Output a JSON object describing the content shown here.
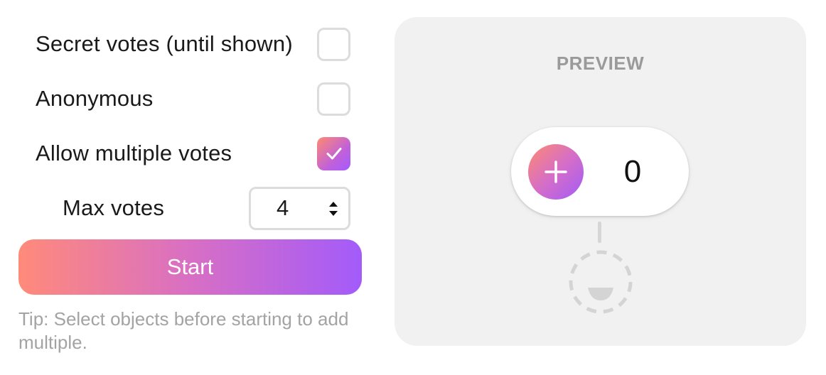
{
  "settings": {
    "secret_votes": {
      "label": "Secret votes (until shown)",
      "checked": false
    },
    "anonymous": {
      "label": "Anonymous",
      "checked": false
    },
    "allow_multiple": {
      "label": "Allow multiple votes",
      "checked": true
    },
    "max_votes": {
      "label": "Max votes",
      "value": "4"
    }
  },
  "start_button": {
    "label": "Start"
  },
  "tip": "Tip: Select objects before starting to add multiple.",
  "preview": {
    "title": "PREVIEW",
    "vote_count": "0"
  },
  "colors": {
    "gradient_start": "#ff8a70",
    "gradient_end": "#a35bfa",
    "panel_bg": "#f1f1f1",
    "muted_text": "#a3a3a3"
  },
  "icons": {
    "checkmark": "check-icon",
    "stepper": "up-down-arrows-icon",
    "add": "plus-icon",
    "avatar": "smiley-placeholder-icon"
  }
}
